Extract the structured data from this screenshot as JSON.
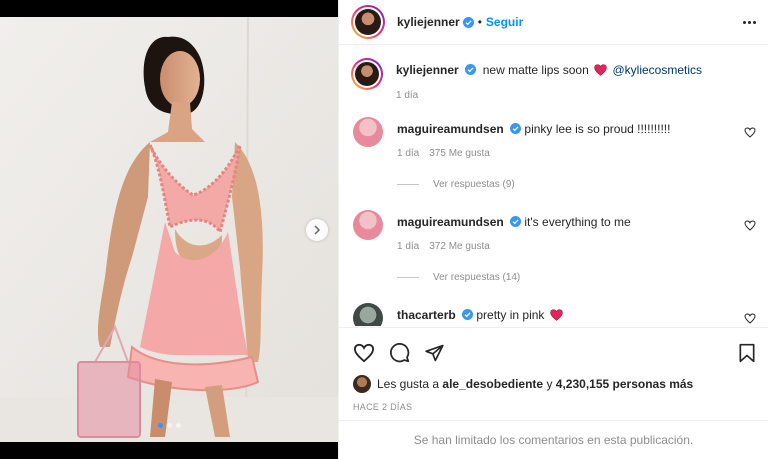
{
  "header": {
    "username": "kyliejenner",
    "separator": "•",
    "follow_label": "Seguir"
  },
  "caption": {
    "username": "kyliejenner",
    "text": "new matte lips soon",
    "mention": "@kyliecosmetics",
    "time": "1 día"
  },
  "comments": [
    {
      "username": "maguireamundsen",
      "text": "pinky lee is so proud !!!!!!!!!!",
      "time": "1 día",
      "likes": "375 Me gusta",
      "replies": "Ver respuestas (9)"
    },
    {
      "username": "maguireamundsen",
      "text": "it's everything to me",
      "time": "1 día",
      "likes": "372 Me gusta",
      "replies": "Ver respuestas (14)"
    },
    {
      "username": "thacarterb",
      "text": "pretty in pink"
    }
  ],
  "likes_summary": {
    "prefix": "Les gusta a",
    "user": "ale_desobediente",
    "middle": "y",
    "count": "4,230,155 personas más"
  },
  "time_ago": "HACE 2 DÍAS",
  "comments_limited": "Se han limitado los comentarios en esta publicación.",
  "carousel": {
    "total": 3,
    "current": 1
  },
  "colors": {
    "accent": "#0095f6",
    "verified": "#3897f0",
    "dress": "#f2a3a3",
    "heart": "#ed4956"
  },
  "icons": [
    "verified-icon",
    "more-icon",
    "heart-icon",
    "comment-icon",
    "share-icon",
    "save-icon",
    "chevron-right-icon"
  ]
}
